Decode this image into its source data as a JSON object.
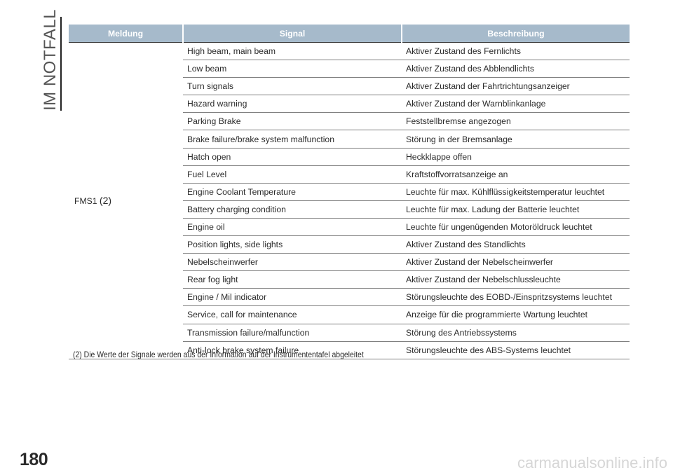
{
  "side_title": "IM NOTFALL",
  "page_number": "180",
  "watermark": "carmanualsonline.info",
  "table": {
    "headers": [
      "Meldung",
      "Signal",
      "Beschreibung"
    ],
    "meldung": "FMS1",
    "meldung_ref": "(2)",
    "rows": [
      {
        "signal": "High beam, main beam",
        "beschreibung": "Aktiver Zustand des Fernlichts"
      },
      {
        "signal": "Low beam",
        "beschreibung": "Aktiver Zustand des Abblendlichts"
      },
      {
        "signal": "Turn signals",
        "beschreibung": "Aktiver Zustand der Fahrtrichtungsanzeiger"
      },
      {
        "signal": "Hazard warning",
        "beschreibung": "Aktiver Zustand der Warnblinkanlage"
      },
      {
        "signal": "Parking Brake",
        "beschreibung": "Feststellbremse angezogen"
      },
      {
        "signal": "Brake failure/brake system malfunction",
        "beschreibung": "Störung in der Bremsanlage"
      },
      {
        "signal": "Hatch open",
        "beschreibung": "Heckklappe offen"
      },
      {
        "signal": "Fuel Level",
        "beschreibung": "Kraftstoffvorratsanzeige an"
      },
      {
        "signal": "Engine Coolant Temperature",
        "beschreibung": "Leuchte für max. Kühlflüssigkeitstemperatur leuchtet"
      },
      {
        "signal": "Battery charging condition",
        "beschreibung": "Leuchte für max. Ladung der Batterie leuchtet"
      },
      {
        "signal": "Engine oil",
        "beschreibung": "Leuchte für ungenügenden Motoröldruck leuchtet"
      },
      {
        "signal": "Position lights, side lights",
        "beschreibung": "Aktiver Zustand des Standlichts"
      },
      {
        "signal": "Nebelscheinwerfer",
        "beschreibung": "Aktiver Zustand der Nebelscheinwerfer"
      },
      {
        "signal": "Rear fog light",
        "beschreibung": "Aktiver Zustand der Nebelschlussleuchte"
      },
      {
        "signal": "Engine / Mil indicator",
        "beschreibung": "Störungsleuchte des EOBD-/Einspritzsystems leuchtet"
      },
      {
        "signal": "Service, call for maintenance",
        "beschreibung": "Anzeige für die programmierte Wartung leuchtet"
      },
      {
        "signal": "Transmission failure/malfunction",
        "beschreibung": "Störung des Antriebssystems"
      },
      {
        "signal": "Anti-lock brake system failure",
        "beschreibung": "Störungsleuchte des ABS-Systems leuchtet"
      }
    ]
  },
  "footnote": "(2) Die Werte der Signale werden aus der Information auf der Instrumententafel abgeleitet"
}
